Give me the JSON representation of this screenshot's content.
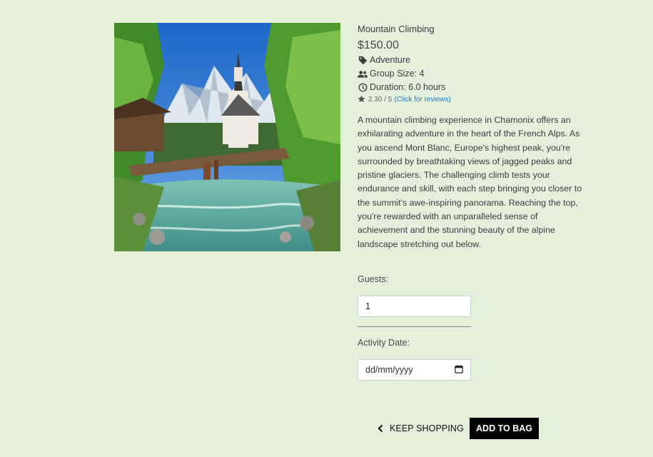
{
  "product": {
    "name": "Mountain Climbing",
    "price": "$150.00",
    "category": "Adventure",
    "group_size": "Group Size: 4",
    "duration": "Duration: 6.0 hours",
    "rating": "2.30 / 5",
    "reviews_link": "(Click for reviews)",
    "description": "A mountain climbing experience in Chamonix offers an exhilarating adventure in the heart of the French Alps. As you ascend Mont Blanc, Europe's highest peak, you're surrounded by breathtaking views of jagged peaks and pristine glaciers. The challenging climb tests your endurance and skill, with each step bringing you closer to the summit's awe-inspiring panorama. Reaching the top, you're rewarded with an unparalleled sense of achievement and the stunning beauty of the alpine landscape stretching out below."
  },
  "form": {
    "guests_label": "Guests:",
    "guests_value": "1",
    "date_label": "Activity Date:",
    "date_placeholder": "dd/mm/yyyy"
  },
  "actions": {
    "keep_shopping": "KEEP SHOPPING",
    "add_to_bag": "ADD TO BAG"
  },
  "icons": {
    "category": "tag-icon",
    "group": "users-icon",
    "duration": "clock-icon",
    "rating": "star-icon",
    "keep_shopping": "chevron-left-icon",
    "date": "calendar-icon"
  },
  "colors": {
    "background": "#e2f0dc",
    "link": "#1f7ad6",
    "button": "#000000"
  }
}
